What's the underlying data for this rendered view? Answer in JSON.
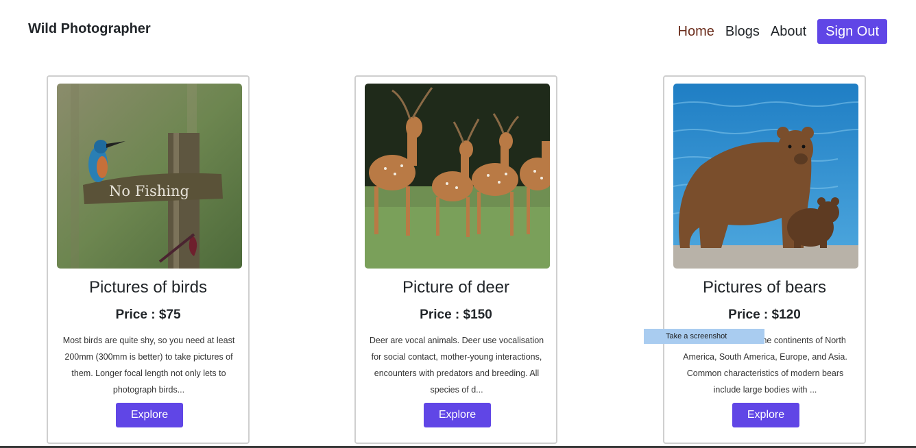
{
  "header": {
    "brand": "Wild Photographer",
    "nav": [
      "Home",
      "Blogs",
      "About"
    ],
    "signout_label": "Sign Out"
  },
  "cards": [
    {
      "title": "Pictures of birds",
      "price": "Price : $75",
      "description": "Most birds are quite shy, so you need at least 200mm (300mm is better) to take pictures of them. Longer focal length not only lets to photograph birds...",
      "sign_text": "No Fishing",
      "button": "Explore"
    },
    {
      "title": "Picture of deer",
      "price": "Price : $150",
      "description": "Deer are vocal animals. Deer use vocalisation for social contact, mother-young interactions, encounters with predators and breeding. All species of d...",
      "button": "Explore"
    },
    {
      "title": "Pictures of bears",
      "price": "Price : $120",
      "description": "Bears are found on the continents of North America, South America, Europe, and Asia. Common characteristics of modern bears include large bodies with ...",
      "button": "Explore"
    }
  ],
  "tooltip": "Take a screenshot",
  "colors": {
    "accent": "#6046e6",
    "active_nav": "#6b2d1c",
    "card_border": "#cfcfcf"
  }
}
